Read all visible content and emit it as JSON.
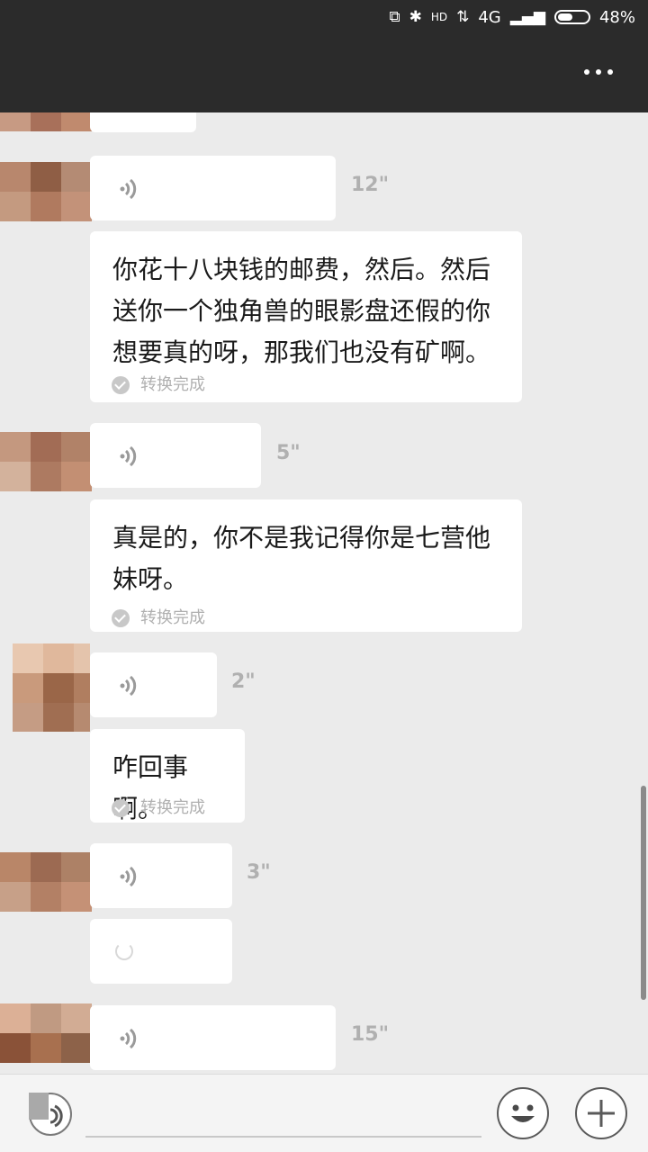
{
  "status_bar": {
    "network": "4G",
    "battery": "48%",
    "hd_label": "HD"
  },
  "header": {
    "more_icon": "more-dots-icon"
  },
  "messages": [
    {
      "type": "voice",
      "duration": "12\""
    },
    {
      "type": "text",
      "text": "你花十八块钱的邮费，然后。然后送你一个独角兽的眼影盘还假的你想要真的呀，那我们也没有矿啊。",
      "status": "转换完成"
    },
    {
      "type": "voice",
      "duration": "5\""
    },
    {
      "type": "text",
      "text": "真是的，你不是我记得你是七营他妹呀。",
      "status": "转换完成"
    },
    {
      "type": "voice",
      "duration": "2\""
    },
    {
      "type": "text",
      "text": "咋回事啊。",
      "status": "转换完成"
    },
    {
      "type": "voice",
      "duration": "3\""
    },
    {
      "type": "converting"
    },
    {
      "type": "voice",
      "duration": "15\""
    }
  ],
  "input_bar": {
    "placeholder": "",
    "icons": [
      "voice-icon",
      "emoji-icon",
      "plus-icon"
    ]
  },
  "colors": {
    "bar_bg": "#2b2b2b",
    "chat_bg": "#ebebeb",
    "bubble": "#ffffff",
    "muted": "#b0b0b0"
  }
}
